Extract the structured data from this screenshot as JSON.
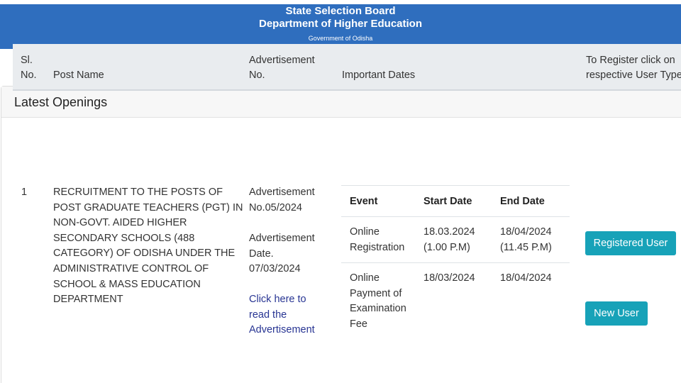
{
  "header": {
    "title": "State Selection Board",
    "subtitle": "Department of Higher Education",
    "tagline": "Government of Odisha"
  },
  "card": {
    "title": "Latest Openings"
  },
  "table": {
    "headers": {
      "sl_line1": "Sl.",
      "sl_line2": "No.",
      "post_name": "Post Name",
      "adv_line1": "Advertisement",
      "adv_line2": "No.",
      "dates": "Important Dates",
      "register_line1": "To Register click on",
      "register_line2": "respective User Type"
    },
    "rows": [
      {
        "sl": "1",
        "post_lines": [
          "RECRUITMENT TO THE POSTS OF",
          "POST GRADUATE TEACHERS (PGT) IN",
          "NON-GOVT. AIDED HIGHER",
          "SECONDARY SCHOOLS (488",
          "CATEGORY) OF ODISHA UNDER THE",
          "ADMINISTRATIVE CONTROL OF",
          "SCHOOL & MASS EDUCATION",
          "DEPARTMENT"
        ],
        "adv_no_lines": [
          "Advertisement",
          "No.05/2024"
        ],
        "adv_date_lines": [
          "Advertisement",
          "Date.",
          "07/03/2024"
        ],
        "link_lines": [
          "Click here to",
          "read the",
          "Advertisement"
        ],
        "dates_table": {
          "headers": {
            "event": "Event",
            "start": "Start Date",
            "end": "End Date"
          },
          "rows": [
            {
              "event_lines": [
                "Online",
                "Registration"
              ],
              "start_lines": [
                "18.03.2024",
                "(1.00 P.M)"
              ],
              "end_lines": [
                "18/04/2024",
                "(11.45 P.M)"
              ]
            },
            {
              "event_lines": [
                "Online",
                "Payment of",
                "Examination",
                "Fee"
              ],
              "start_lines": [
                "18/03/2024"
              ],
              "end_lines": [
                "18/04/2024"
              ]
            }
          ]
        },
        "buttons": {
          "registered": "Registered User",
          "new": "New User"
        }
      }
    ]
  },
  "colors": {
    "header_bg": "#2f6ebe",
    "button_bg": "#17a2b8",
    "link": "#283593",
    "table_head_bg": "#e9ecef"
  }
}
